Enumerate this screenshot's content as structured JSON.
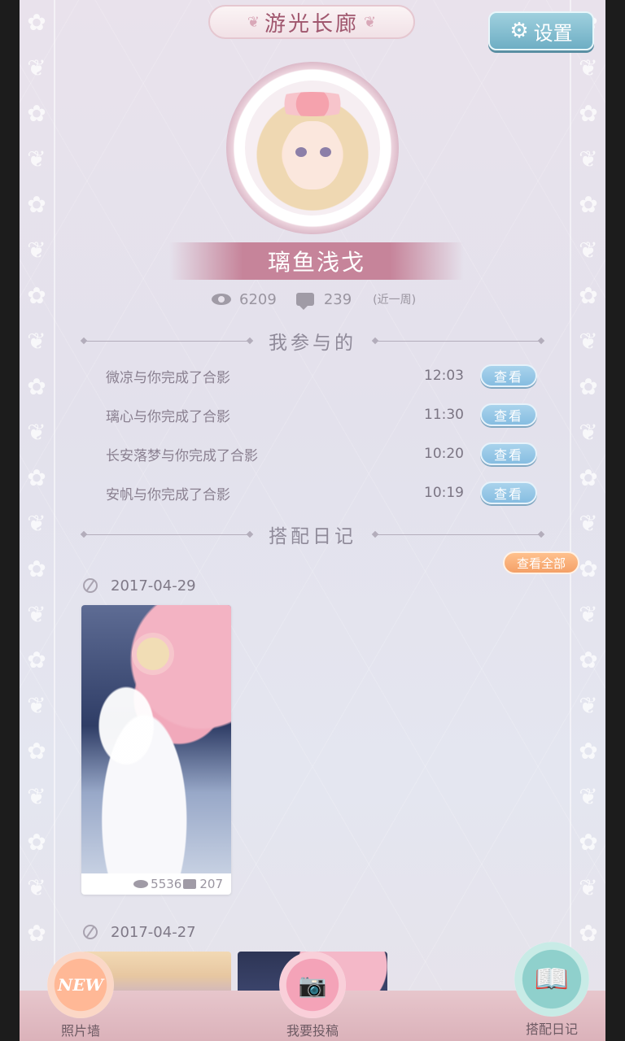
{
  "header": {
    "title": "游光长廊",
    "settings_label": "设置",
    "settings_icon": "gear-icon"
  },
  "profile": {
    "name": "璃鱼浅戈",
    "views": "6209",
    "comments": "239",
    "period": "(近一周)"
  },
  "participation": {
    "heading": "我参与的",
    "items": [
      {
        "text": "微凉与你完成了合影",
        "time": "12:03",
        "button": "查看"
      },
      {
        "text": "璃心与你完成了合影",
        "time": "11:30",
        "button": "查看"
      },
      {
        "text": "长安落梦与你完成了合影",
        "time": "10:20",
        "button": "查看"
      },
      {
        "text": "安帆与你完成了合影",
        "time": "10:19",
        "button": "查看"
      }
    ]
  },
  "diary": {
    "heading": "搭配日记",
    "view_all_label": "查看全部",
    "entries": [
      {
        "date": "2017-04-29",
        "views": "5536",
        "comments": "207"
      },
      {
        "date": "2017-04-27"
      }
    ]
  },
  "bottom_nav": {
    "photos_wall": {
      "label": "照片墙",
      "badge": "NEW"
    },
    "submit": {
      "label": "我要投稿"
    },
    "diary": {
      "label": "搭配日记"
    }
  },
  "colors": {
    "accent_pink": "#c6849a",
    "button_blue": "#86bde1",
    "button_orange": "#f4a067",
    "settings_teal": "#6eaec4"
  }
}
